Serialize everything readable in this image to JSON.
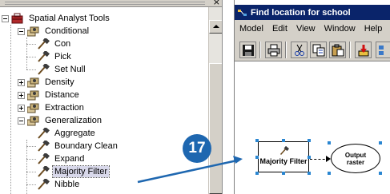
{
  "toolbox": {
    "close_glyph": "×",
    "tree": [
      {
        "label": "Spatial Analyst Tools",
        "kind": "toolbox",
        "expanded": true
      },
      {
        "label": "Conditional",
        "kind": "toolset",
        "expanded": true
      },
      {
        "label": "Con",
        "kind": "tool"
      },
      {
        "label": "Pick",
        "kind": "tool"
      },
      {
        "label": "Set Null",
        "kind": "tool"
      },
      {
        "label": "Density",
        "kind": "toolset",
        "expanded": false
      },
      {
        "label": "Distance",
        "kind": "toolset",
        "expanded": false
      },
      {
        "label": "Extraction",
        "kind": "toolset",
        "expanded": false
      },
      {
        "label": "Generalization",
        "kind": "toolset",
        "expanded": true
      },
      {
        "label": "Aggregate",
        "kind": "tool"
      },
      {
        "label": "Boundary Clean",
        "kind": "tool"
      },
      {
        "label": "Expand",
        "kind": "tool"
      },
      {
        "label": "Majority Filter",
        "kind": "tool",
        "selected": true
      },
      {
        "label": "Nibble",
        "kind": "tool"
      }
    ]
  },
  "window": {
    "title": "Find location for school",
    "menu": [
      "Model",
      "Edit",
      "View",
      "Window",
      "Help"
    ],
    "toolbar_icons": [
      "save-icon",
      "print-icon",
      "cut-icon",
      "copy-icon",
      "paste-icon",
      "add-data-icon",
      "more-icon"
    ]
  },
  "model": {
    "tool_label": "Majority Filter",
    "output_label_line1": "Output",
    "output_label_line2": "raster"
  },
  "callout": {
    "step": "17"
  },
  "colors": {
    "title_bar": "#0a246a",
    "callout": "#1e67b0",
    "selection_handle": "#2a86d1",
    "chrome": "#d4d0c8"
  }
}
